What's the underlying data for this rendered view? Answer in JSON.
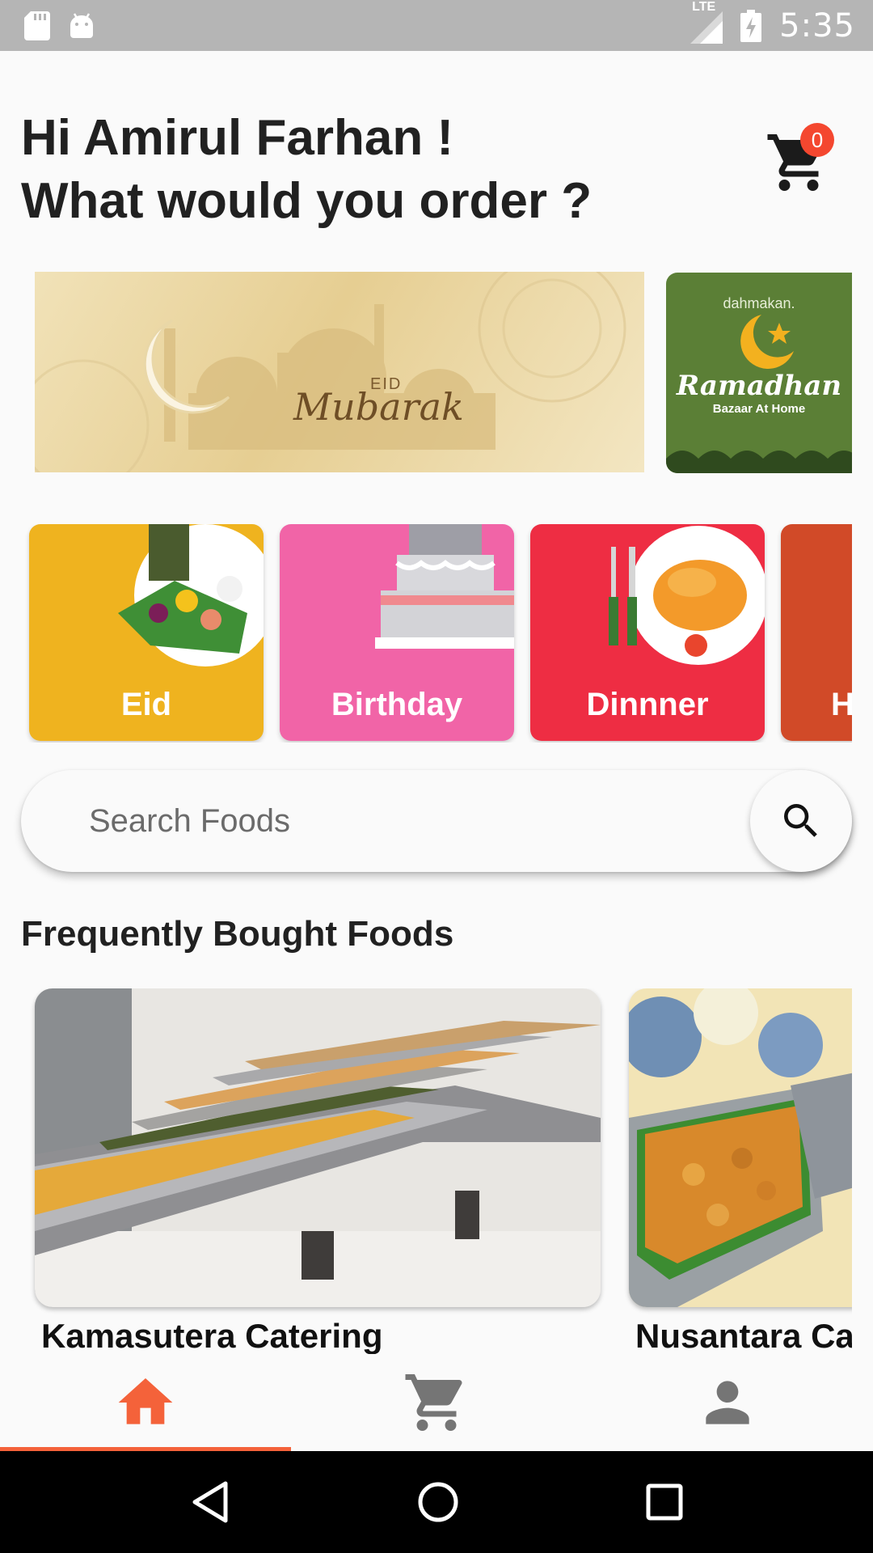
{
  "status_bar": {
    "time": "5:35",
    "network": "LTE",
    "icons": [
      "sd-card-icon",
      "android-icon",
      "signal-icon",
      "battery-charging-icon"
    ]
  },
  "header": {
    "greeting_line1": "Hi Amirul Farhan !",
    "greeting_line2": "What would you order ?",
    "cart_count": "0"
  },
  "banners": [
    {
      "small_text": "EID",
      "script_text": "Mubarak"
    },
    {
      "brand": "dahmakan.",
      "title": "Ramadhan",
      "subtitle": "Bazaar At Home"
    }
  ],
  "categories": [
    {
      "label": "Eid",
      "color": "#efb31f"
    },
    {
      "label": "Birthday",
      "color": "#f164a7"
    },
    {
      "label": "Dinnner",
      "color": "#ee2d43"
    },
    {
      "label": "H",
      "color": "#d14a28"
    }
  ],
  "search": {
    "placeholder": "Search Foods"
  },
  "section": {
    "title": "Frequently Bought Foods"
  },
  "foods": [
    {
      "name": "Kamasutera Catering"
    },
    {
      "name": "Nusantara Cat"
    }
  ],
  "bottom_nav": {
    "items": [
      "home-icon",
      "cart-icon",
      "profile-icon"
    ],
    "active_index": 0,
    "accent": "#f4623a"
  }
}
